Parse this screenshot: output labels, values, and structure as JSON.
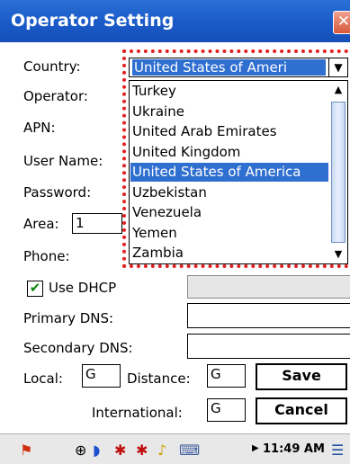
{
  "window": {
    "title": "Operator Setting",
    "close_label": "✕"
  },
  "labels": {
    "country": "Country:",
    "operator": "Operator:",
    "apn": "APN:",
    "user_name": "User Name:",
    "password": "Password:",
    "area": "Area:",
    "phone": "Phone:",
    "use_dhcp": "Use DHCP",
    "primary_dns": "Primary DNS:",
    "secondary_dns": "Secondary DNS:",
    "local": "Local:",
    "distance": "Distance:",
    "international": "International:"
  },
  "fields": {
    "country_selected": "United States of Ameri",
    "area_value": "1",
    "local_value": "G",
    "distance_value": "G",
    "international_value": "G",
    "use_dhcp_checked": true
  },
  "country_list": {
    "items": [
      "Turkey",
      "Ukraine",
      "United Arab Emirates",
      "United Kingdom",
      "United States of America",
      "Uzbekistan",
      "Venezuela",
      "Yemen",
      "Zambia"
    ],
    "selected_index": 4
  },
  "buttons": {
    "save": "Save",
    "cancel": "Cancel"
  },
  "taskbar": {
    "clock": "11:49 AM",
    "icons": [
      "windows-flag-icon",
      "network-icon",
      "bluetooth-icon",
      "antenna-icon",
      "antenna-icon",
      "speaker-icon",
      "keyboard-icon",
      "expand-icon",
      "keyboard-toggle-icon"
    ]
  }
}
